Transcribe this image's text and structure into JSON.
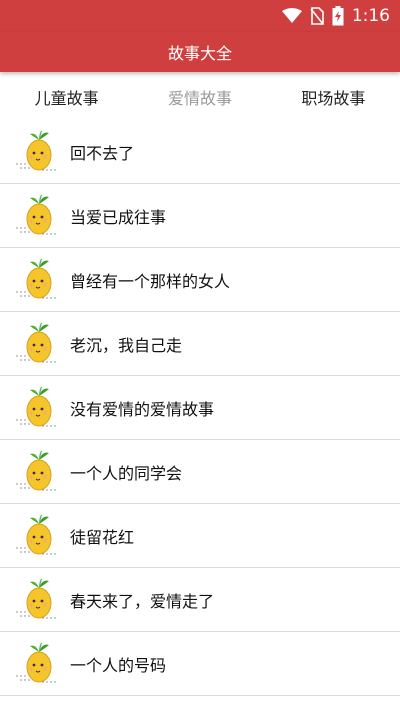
{
  "status": {
    "time": "1:16"
  },
  "app": {
    "title": "故事大全"
  },
  "tabs": [
    {
      "label": "儿童故事"
    },
    {
      "label": "爱情故事"
    },
    {
      "label": "职场故事"
    }
  ],
  "stories": [
    {
      "title": "回不去了"
    },
    {
      "title": "当爱已成往事"
    },
    {
      "title": "曾经有一个那样的女人"
    },
    {
      "title": "老沉，我自己走"
    },
    {
      "title": "没有爱情的爱情故事"
    },
    {
      "title": "一个人的同学会"
    },
    {
      "title": "徒留花红"
    },
    {
      "title": "春天来了，爱情走了"
    },
    {
      "title": "一个人的号码"
    }
  ],
  "colors": {
    "primary": "#cf3f3f",
    "active_tab": "#9a9a9a"
  }
}
